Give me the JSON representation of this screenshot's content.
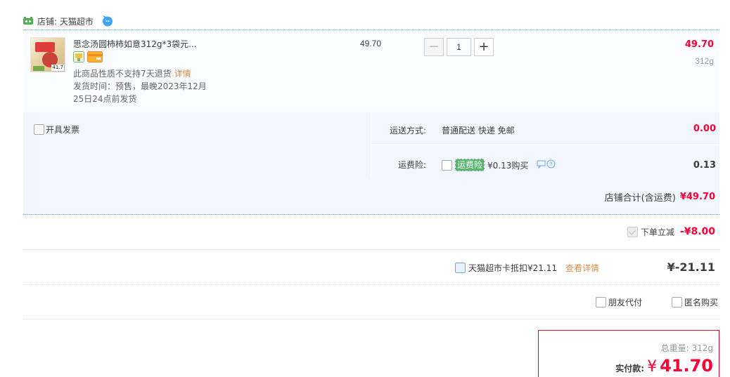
{
  "shop": {
    "label": "店铺: 天猫超市"
  },
  "item": {
    "title": "思念汤圆柿柿如意312g*3袋元...",
    "thumb_price": "41.7",
    "note": "此商品性质不支持7天退货",
    "note_link": "详情",
    "ship_time": "发货时间：预售，最晚2023年12月25日24点前发货",
    "unit_price": "49.70",
    "quantity": "1",
    "minus": "−",
    "plus": "+",
    "subtotal": "49.70",
    "weight": "312g"
  },
  "invoice": {
    "label": "开具发票"
  },
  "shipping": {
    "label": "运送方式:",
    "value": "普通配送 快递 免邮",
    "price": "0.00"
  },
  "insurance": {
    "label": "运费险:",
    "tag": "运费险",
    "buy": "¥0.13购买",
    "price": "0.13"
  },
  "shop_total": {
    "label": "店铺合计(含运费)",
    "value": "¥49.70"
  },
  "discount": {
    "label": "下单立减",
    "value": "-¥8.00"
  },
  "card": {
    "label": "天猫超市卡抵扣¥21.11",
    "detail": "查看详情",
    "value": "¥-21.11"
  },
  "options": {
    "friend_pay": "朋友代付",
    "anon_buy": "匿名购买"
  },
  "payment": {
    "weight": "总重量: 312g",
    "label": "实付款:",
    "currency": "¥",
    "value": "41.70"
  },
  "colors": {
    "accent": "#ff0036",
    "link": "#d38e4d",
    "panel": "#f2f7ff"
  }
}
